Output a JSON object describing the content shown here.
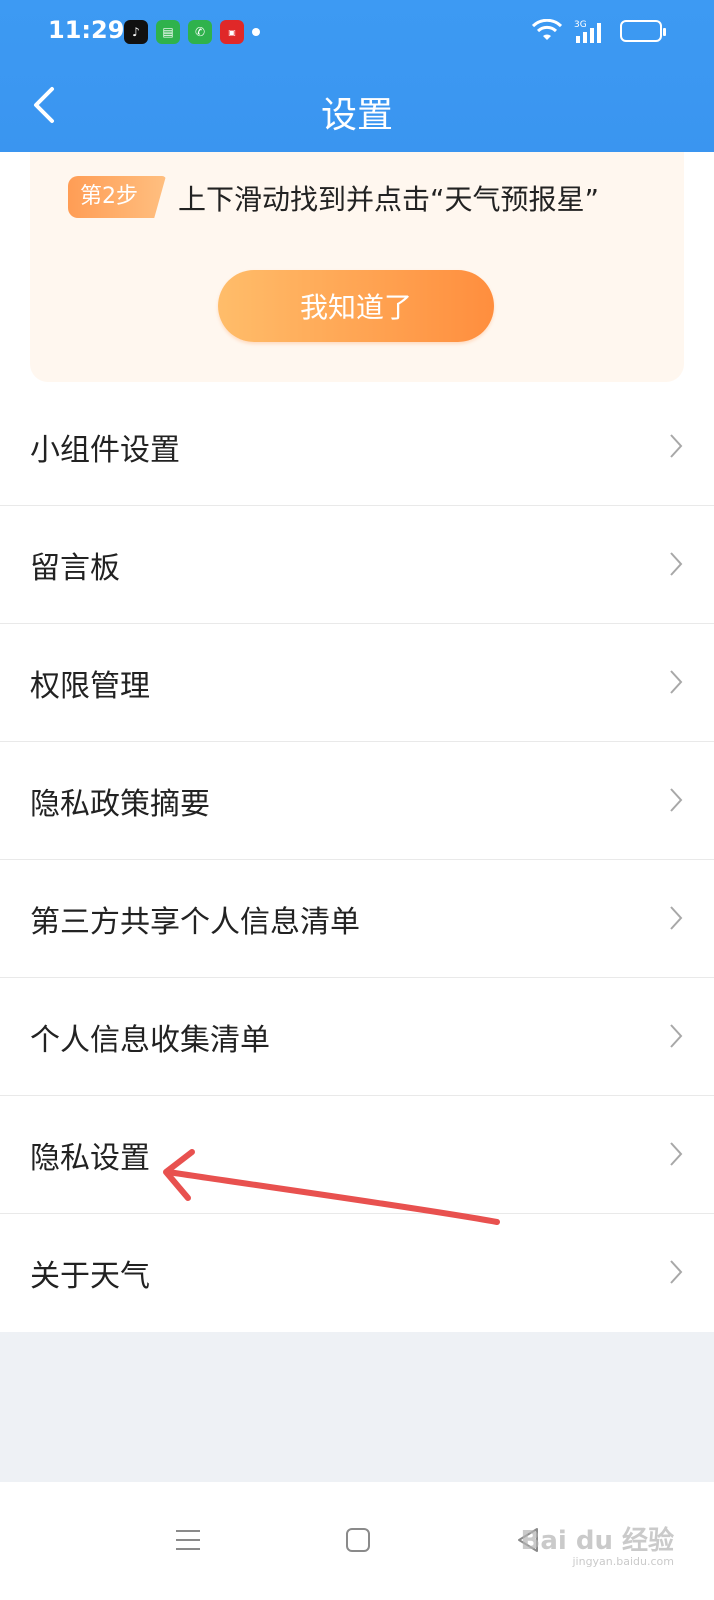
{
  "status_bar": {
    "time": "11:29",
    "network": "3G"
  },
  "app_bar": {
    "title": "设置"
  },
  "tip": {
    "step_badge": "第2步",
    "text": "上下滑动找到并点击“天气预报星”",
    "confirm_label": "我知道了"
  },
  "settings": {
    "items": [
      {
        "label": "小组件设置"
      },
      {
        "label": "留言板"
      },
      {
        "label": "权限管理"
      },
      {
        "label": "隐私政策摘要"
      },
      {
        "label": "第三方共享个人信息清单"
      },
      {
        "label": "个人信息收集清单"
      },
      {
        "label": "隐私设置"
      },
      {
        "label": "关于天气"
      }
    ]
  },
  "watermark": {
    "brand": "Bai du 经验",
    "url": "jingyan.baidu.com"
  },
  "colors": {
    "header_blue": "#3a95f0",
    "accent_orange": "#ff8e3e",
    "annotation_red": "#e8514f"
  }
}
